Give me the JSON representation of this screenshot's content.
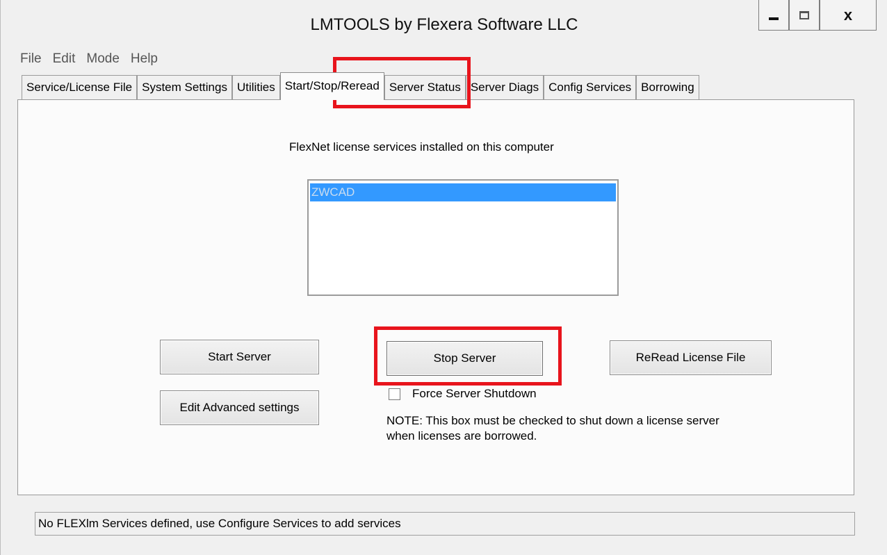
{
  "window": {
    "title": "LMTOOLS by Flexera Software LLC"
  },
  "menu": [
    "File",
    "Edit",
    "Mode",
    "Help"
  ],
  "tabs": [
    {
      "label": "Service/License File"
    },
    {
      "label": "System Settings"
    },
    {
      "label": "Utilities"
    },
    {
      "label": "Start/Stop/Reread",
      "active": true
    },
    {
      "label": "Server Status"
    },
    {
      "label": "Server Diags"
    },
    {
      "label": "Config Services"
    },
    {
      "label": "Borrowing"
    }
  ],
  "panel": {
    "services_label": "FlexNet license services installed on this computer",
    "services": [
      "ZWCAD"
    ],
    "buttons": {
      "start": "Start Server",
      "stop": "Stop Server",
      "reread": "ReRead License File",
      "advanced": "Edit Advanced settings"
    },
    "force_shutdown_label": "Force Server Shutdown",
    "note_line1": "NOTE:  This box must be checked to shut down a license server",
    "note_line2": "when licenses are borrowed."
  },
  "status": "No FLEXlm Services defined, use Configure Services to add services",
  "colors": {
    "highlight": "#e8141c",
    "selection": "#3399ff"
  },
  "icons": [
    "minimize-icon",
    "maximize-icon",
    "close-icon"
  ]
}
